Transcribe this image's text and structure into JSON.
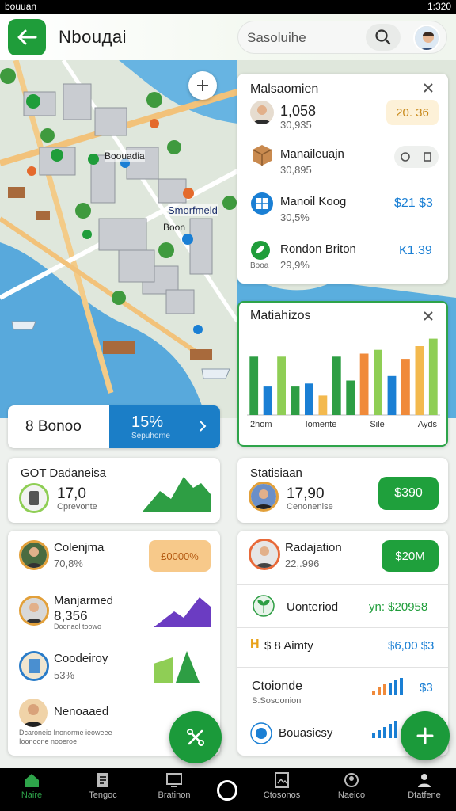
{
  "status": {
    "left": "bouuan",
    "right": "1:320"
  },
  "header": {
    "title": "Nbouдai",
    "search_text": "Sasoluihe"
  },
  "map": {
    "label_1": "Boouadia",
    "label_2": "Smorfmeld",
    "label_3": "Boon"
  },
  "panel1": {
    "title": "Malsaomien",
    "rows": [
      {
        "name": "1,058",
        "sub": "30,935",
        "value": "20. 36"
      },
      {
        "name": "Manaileuajn",
        "sub": "30,895",
        "value": ""
      },
      {
        "name": "Manoil Koog",
        "sub": "30,5%",
        "value": "$21 $3"
      },
      {
        "name": "Rondon Briton",
        "sub": "29,9%",
        "value": "K1.39",
        "tag": "Booa"
      }
    ]
  },
  "panel2": {
    "title": "Matiahizos",
    "x_labels": [
      "2hom",
      "Iomente",
      "Sile",
      "Ayds"
    ],
    "bars": [
      {
        "value": 78,
        "color": "#2e9e44"
      },
      {
        "value": 38,
        "color": "#1a7fd4"
      },
      {
        "value": 78,
        "color": "#8fce55"
      },
      {
        "value": 38,
        "color": "#2e9e44"
      },
      {
        "value": 42,
        "color": "#1a7fd4"
      },
      {
        "value": 26,
        "color": "#f3b94e"
      },
      {
        "value": 78,
        "color": "#2e9e44"
      },
      {
        "value": 46,
        "color": "#2e9e44"
      },
      {
        "value": 82,
        "color": "#f08a3a"
      },
      {
        "value": 87,
        "color": "#8fce55"
      },
      {
        "value": 52,
        "color": "#1a7fd4"
      },
      {
        "value": 75,
        "color": "#f08a3a"
      },
      {
        "value": 92,
        "color": "#f3b94e"
      },
      {
        "value": 102,
        "color": "#8fce55"
      }
    ]
  },
  "summary": {
    "label": "8 Bonoo",
    "percent": "15%",
    "sub": "Sepuhorne"
  },
  "card_got": {
    "title": "GOT Dadaneisa",
    "value": "17,0",
    "sub": "Cprevonte"
  },
  "card_stats": {
    "title": "Statisiaan",
    "value": "17,90",
    "sub": "Cenonenise",
    "button": "$390"
  },
  "list_left": [
    {
      "name": "Colenjma",
      "sub": "70,8%",
      "badge": "£0000%"
    },
    {
      "name": "Manjarmed",
      "sub": "8,356",
      "extra": "Doonaol toowo"
    },
    {
      "name": "Coodeiroy",
      "sub": "53%"
    },
    {
      "name": "Nenoaaed",
      "sub": "Dcaroneio Inonorme ieoweee Ioonoone nooeroe"
    }
  ],
  "list_right": [
    {
      "name": "Radajation",
      "sub": "22,.996",
      "button": "$20M"
    },
    {
      "name": "Uonteriod",
      "value": "yn: $20958"
    },
    {
      "name": "$ 8 Aimty",
      "value": "$6,00 $3",
      "prefix": "H"
    },
    {
      "name": "Ctoionde",
      "sub": "S.Sosoonion",
      "value": "$3"
    },
    {
      "name": "Bouasicsy"
    }
  ],
  "nav": [
    "Naire",
    "Tengoc",
    "Bratinon",
    "Ctosonos",
    "Naeico",
    "Dtatfene"
  ],
  "colors": {
    "accent": "#1f9d3a",
    "blue": "#1a7fd4"
  }
}
